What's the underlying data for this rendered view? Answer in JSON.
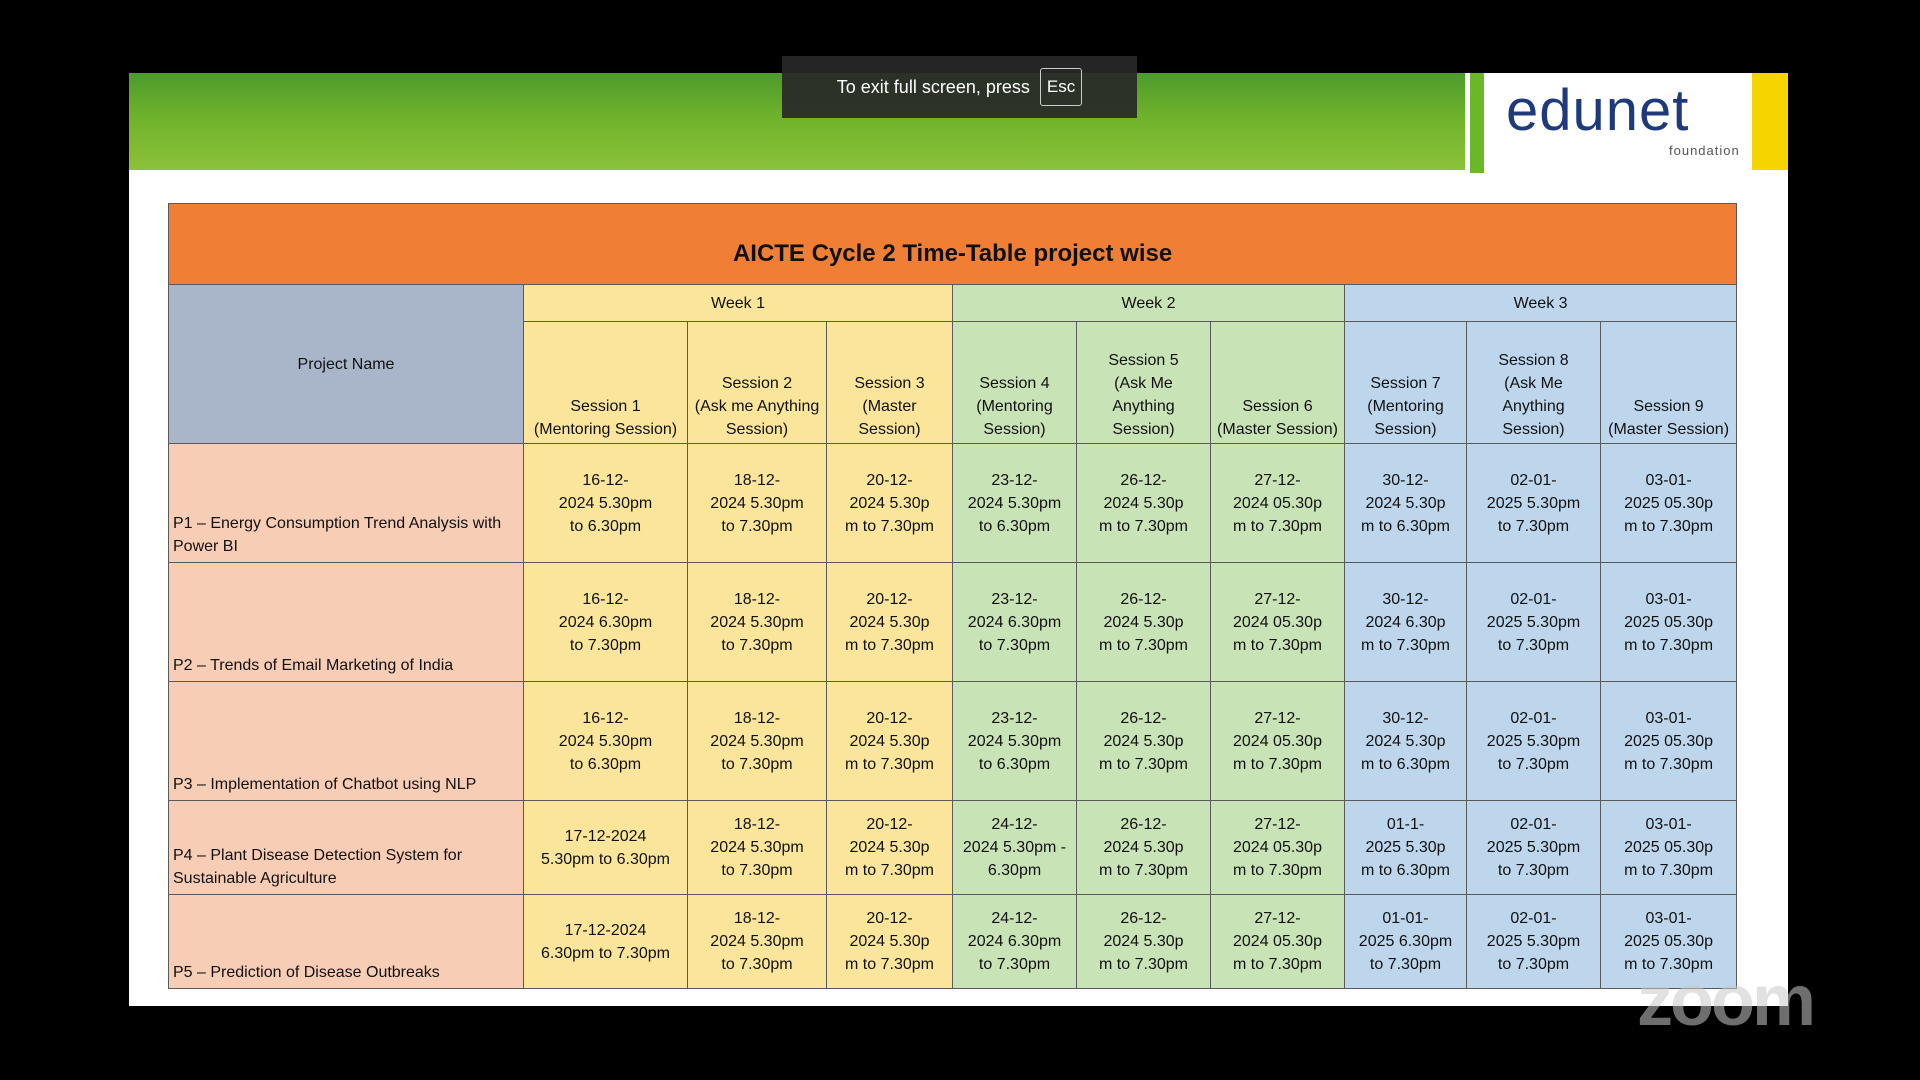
{
  "toast": {
    "text": "To exit full screen, press",
    "key": "Esc"
  },
  "logo": {
    "name": "edunet",
    "sub": "foundation"
  },
  "title": "AICTE Cycle 2 Time-Table project  wise",
  "project_header": "Project Name",
  "weeks": [
    "Week 1",
    "Week 2",
    "Week 3"
  ],
  "sessions": [
    "Session 1\n(Mentoring Session)",
    "Session 2\n(Ask me Anything\nSession)",
    "Session 3\n(Master\nSession)",
    "Session 4\n(Mentoring\nSession)",
    "Session 5\n(Ask Me\nAnything\nSession)",
    "Session 6\n(Master Session)",
    "Session 7\n(Mentoring\nSession)",
    "Session 8\n(Ask Me\nAnything\nSession)",
    "Session 9\n(Master Session)"
  ],
  "rows": [
    {
      "project": "P1 – Energy Consumption Trend Analysis with Power BI",
      "cells": [
        "16-12-\n2024      5.30pm\nto 6.30pm",
        "18-12-\n2024      5.30pm\nto 7.30pm",
        "20-12-\n2024      5.30p\nm to 7.30pm",
        "23-12-\n2024   5.30pm\nto 6.30pm",
        "26-12-\n2024        5.30p\nm to 7.30pm",
        "27-12-\n2024       05.30p\nm to 7.30pm",
        "30-12-\n2024      5.30p\nm to 6.30pm",
        "02-01-\n2025   5.30pm\nto 7.30pm",
        "03-01-\n2025      05.30p\nm to 7.30pm"
      ]
    },
    {
      "project": "P2 – Trends of Email Marketing of India",
      "cells": [
        "16-12-\n2024      6.30pm\nto 7.30pm",
        "18-12-\n2024      5.30pm\nto 7.30pm",
        "20-12-\n2024      5.30p\nm to 7.30pm",
        "23-12-\n2024   6.30pm\nto 7.30pm",
        "26-12-\n2024        5.30p\nm to 7.30pm",
        "27-12-\n2024       05.30p\nm to 7.30pm",
        "30-12-\n2024      6.30p\nm to 7.30pm",
        "02-01-\n2025   5.30pm\nto 7.30pm",
        "03-01-\n2025      05.30p\nm to 7.30pm"
      ]
    },
    {
      "project": "P3 – Implementation of Chatbot using NLP",
      "cells": [
        "16-12-\n2024      5.30pm\nto 6.30pm",
        "18-12-\n2024      5.30pm\nto 7.30pm",
        "20-12-\n2024      5.30p\nm to 7.30pm",
        "23-12-\n2024   5.30pm\nto 6.30pm",
        "26-12-\n2024        5.30p\nm to 7.30pm",
        "27-12-\n2024       05.30p\nm to 7.30pm",
        "30-12-\n2024      5.30p\nm to 6.30pm",
        "02-01-\n2025   5.30pm\nto 7.30pm",
        "03-01-\n2025      05.30p\nm to 7.30pm"
      ]
    },
    {
      "project": "P4 – Plant Disease Detection System for Sustainable Agriculture",
      "cells": [
        "17-12-2024\n5.30pm to 6.30pm",
        "18-12-\n2024      5.30pm\nto 7.30pm",
        "20-12-\n2024      5.30p\nm to 7.30pm",
        "24-12-\n2024  5.30pm -\n6.30pm",
        "26-12-\n2024        5.30p\nm to 7.30pm",
        "27-12-\n2024       05.30p\nm to 7.30pm",
        "01-1-\n2025        5.30p\nm to 6.30pm",
        "02-01-\n2025   5.30pm\nto 7.30pm",
        "03-01-\n2025      05.30p\nm to 7.30pm"
      ]
    },
    {
      "project": "P5 – Prediction of Disease Outbreaks",
      "cells": [
        "17-12-2024\n6.30pm to 7.30pm",
        "18-12-\n2024      5.30pm\nto 7.30pm",
        "20-12-\n2024      5.30p\nm to 7.30pm",
        "24-12-\n2024  6.30pm\nto 7.30pm",
        "26-12-\n2024        5.30p\nm to 7.30pm",
        "27-12-\n2024       05.30p\nm to 7.30pm",
        "01-01-\n2025   6.30pm\nto 7.30pm",
        "02-01-\n2025   5.30pm\nto 7.30pm",
        "03-01-\n2025      05.30p\nm to 7.30pm"
      ]
    }
  ],
  "watermark": "zoom"
}
